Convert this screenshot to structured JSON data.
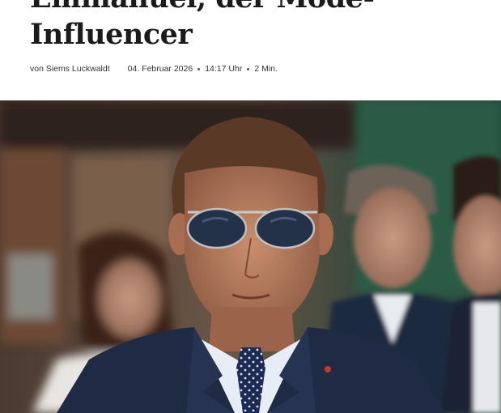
{
  "article": {
    "title_line1": "Emmanuel, der Mode-",
    "title_line2": "Influencer",
    "byline": {
      "author": "von Siems Luckwaldt",
      "date": "04. Februar 2026",
      "time": "14:17 Uhr",
      "read_time": "2 Min."
    }
  },
  "hero_image": {
    "subject": "man in aviator sunglasses, navy suit, dotted tie",
    "accent": "#1f2a44"
  }
}
